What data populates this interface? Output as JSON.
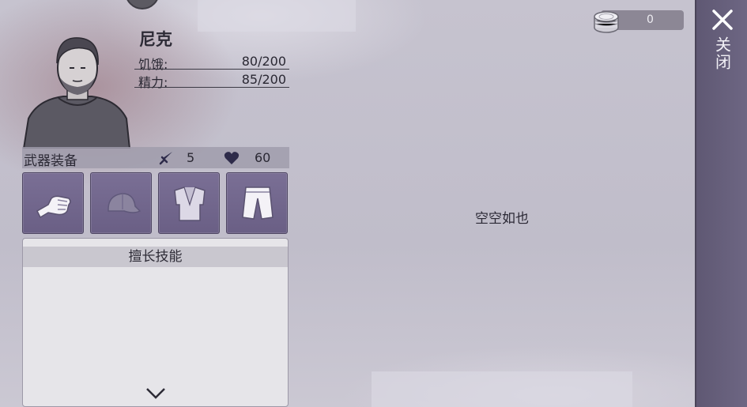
{
  "character": {
    "name": "尼克",
    "stats": [
      {
        "label": "饥饿:",
        "value": "80/200"
      },
      {
        "label": "精力:",
        "value": "85/200"
      }
    ]
  },
  "equipment": {
    "title": "武器装备",
    "attack": "5",
    "health": "60",
    "slots": [
      "fist-icon",
      "cap-icon",
      "shirt-icon",
      "shorts-icon"
    ]
  },
  "skills": {
    "title": "擅长技能"
  },
  "inventory": {
    "empty_text": "空空如也"
  },
  "currency": {
    "coins": "0",
    "icon": "coin-stack-icon"
  },
  "close": {
    "label": "关闭"
  },
  "colors": {
    "slot_bg": "#7a6f95",
    "close_strip": "#665f7b",
    "panel": "#e6e5e9"
  }
}
